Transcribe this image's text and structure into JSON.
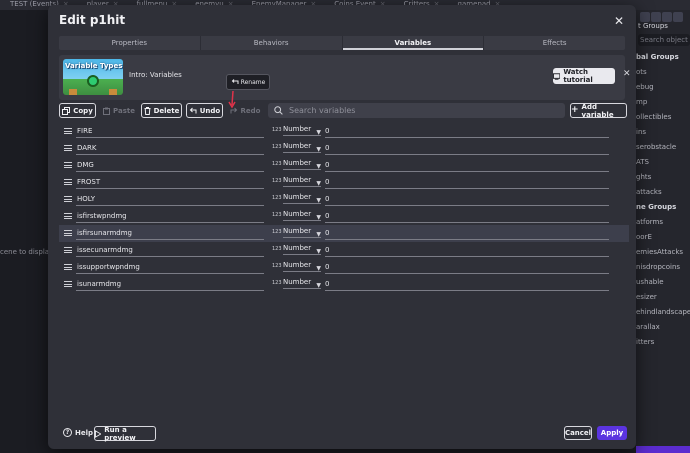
{
  "background": {
    "tabs": [
      {
        "label": "TEST (Events)"
      },
      {
        "label": "player"
      },
      {
        "label": "fullmenu"
      },
      {
        "label": "enemyu"
      },
      {
        "label": "EnemyManager"
      },
      {
        "label": "Coins Event"
      },
      {
        "label": "Critters"
      },
      {
        "label": "gamepad"
      }
    ],
    "left_hint": "cene to display",
    "right_panel": {
      "header": "t Groups",
      "search_placeholder": "Search object g",
      "global_groups_label": "bal Groups",
      "global_items": [
        "ots",
        "ebug",
        "mp",
        "ollectibles",
        "ins",
        "serobstacle",
        "ATS",
        "ghts",
        "attacks"
      ],
      "scene_groups_label": "ne Groups",
      "scene_items": [
        "atforms",
        "oorE",
        "emiesAttacks",
        "nisdropcoins",
        "ushable",
        "esizer",
        "ehindlandscape",
        "arallax",
        "itters"
      ]
    }
  },
  "dialog": {
    "title": "Edit p1hit",
    "tabs": [
      {
        "label": "Properties",
        "active": false
      },
      {
        "label": "Behaviors",
        "active": false
      },
      {
        "label": "Variables",
        "active": true
      },
      {
        "label": "Effects",
        "active": false
      }
    ],
    "intro": {
      "thumb_text": "Variable Types",
      "label": "Intro: Variables",
      "watch_label": "Watch tutorial"
    },
    "rename_tooltip": "Rename",
    "toolbar": {
      "copy": "Copy",
      "paste": "Paste",
      "delete": "Delete",
      "undo": "Undo",
      "redo": "Redo",
      "search_placeholder": "Search variables",
      "add_variable": "Add variable"
    },
    "variables": [
      {
        "name": "FIRE",
        "type": "Number",
        "value": "0"
      },
      {
        "name": "DARK",
        "type": "Number",
        "value": "0"
      },
      {
        "name": "DMG",
        "type": "Number",
        "value": "0"
      },
      {
        "name": "FROST",
        "type": "Number",
        "value": "0"
      },
      {
        "name": "HOLY",
        "type": "Number",
        "value": "0"
      },
      {
        "name": "isfirstwpndmg",
        "type": "Number",
        "value": "0"
      },
      {
        "name": "isfirsunarmdmg",
        "type": "Number",
        "value": "0"
      },
      {
        "name": "issecunarmdmg",
        "type": "Number",
        "value": "0"
      },
      {
        "name": "issupportwpndmg",
        "type": "Number",
        "value": "0"
      },
      {
        "name": "isunarmdmg",
        "type": "Number",
        "value": "0"
      }
    ],
    "selected_index": 6,
    "type_icon_text": "123",
    "footer": {
      "help": "Help",
      "run_preview": "Run a preview",
      "cancel": "Cancel",
      "apply": "Apply"
    }
  },
  "colors": {
    "accent": "#5b34e0",
    "dialog_bg": "#2f3038",
    "backdrop": "#1b1c22"
  }
}
